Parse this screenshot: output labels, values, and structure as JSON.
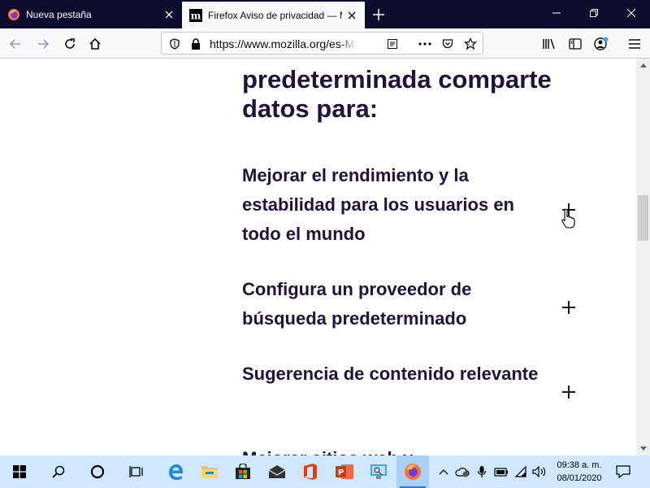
{
  "tabs": [
    {
      "title": "Nueva pestaña"
    },
    {
      "title": "Firefox Aviso de privacidad — Mozilla"
    }
  ],
  "url": "https://www.mozilla.org/es-MX/privacy/firefox/",
  "content": {
    "heading": "predeterminada comparte datos para:",
    "accordion": [
      {
        "label": "Mejorar el rendimiento y la estabilidad para los usuarios en todo el mundo"
      },
      {
        "label": "Configura un proveedor de búsqueda predeterminado"
      },
      {
        "label": "Sugerencia de contenido relevante"
      },
      {
        "label": "Mejorar sitios web y"
      }
    ]
  },
  "clock": {
    "time": "09:38 a. m.",
    "date": "08/01/2020"
  },
  "colors": {
    "heading": "#20123a",
    "tabbar": "#0c0c2e",
    "taskbar": "#cfe7ff"
  }
}
